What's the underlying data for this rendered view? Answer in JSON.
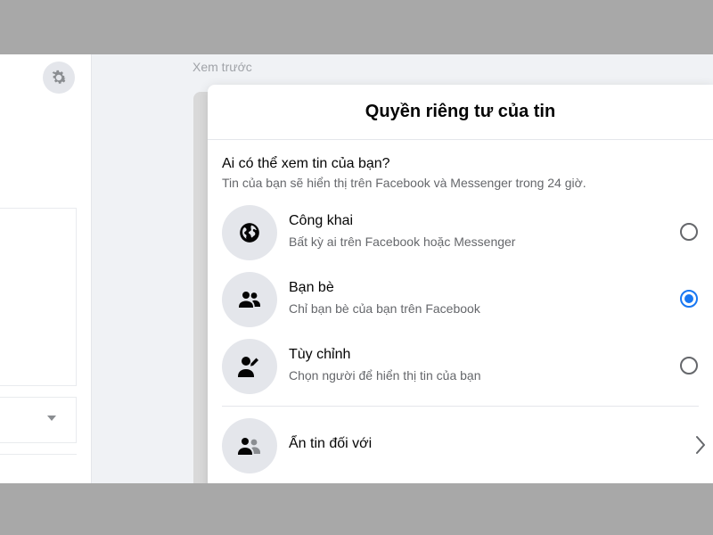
{
  "preview": {
    "label": "Xem trước"
  },
  "dialog": {
    "title": "Quyền riêng tư của tin",
    "question": "Ai có thể xem tin của bạn?",
    "subtitle": "Tin của bạn sẽ hiển thị trên Facebook và Messenger trong 24 giờ.",
    "options": [
      {
        "icon": "globe-icon",
        "title": "Công khai",
        "desc": "Bất kỳ ai trên Facebook hoặc Messenger",
        "selected": false
      },
      {
        "icon": "friends-icon",
        "title": "Bạn bè",
        "desc": "Chỉ bạn bè của bạn trên Facebook",
        "selected": true
      },
      {
        "icon": "person-edit-icon",
        "title": "Tùy chỉnh",
        "desc": "Chọn người để hiển thị tin của bạn",
        "selected": false
      }
    ],
    "hide_story": {
      "icon": "hide-people-icon",
      "label": "Ẩn tin đối với"
    }
  },
  "colors": {
    "accent": "#1877f2",
    "text": "#050505",
    "secondary": "#65676b",
    "icon_bg": "#e4e6eb"
  }
}
